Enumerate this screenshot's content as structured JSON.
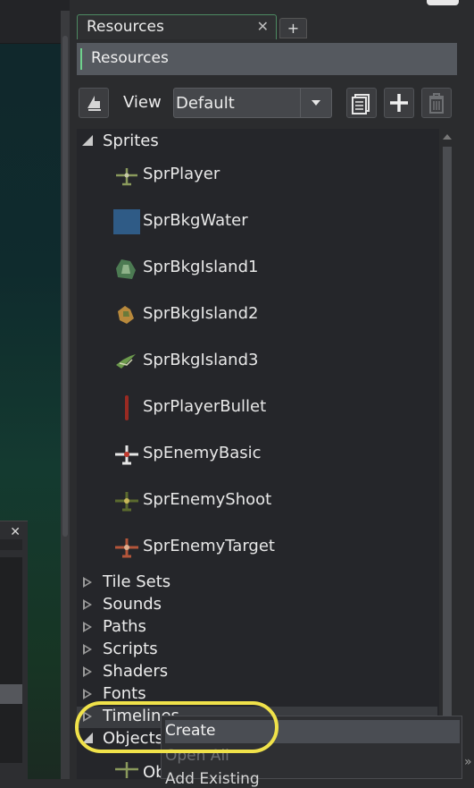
{
  "workspace": {
    "close_glyph": "✕"
  },
  "resources_tab": {
    "label": "Resources",
    "close_glyph": "✕",
    "add_glyph": "+"
  },
  "header": {
    "title": "Resources"
  },
  "toolbar": {
    "view_label": "View",
    "view_value": "Default",
    "buttons": [
      "collapse-icon",
      "copy-list-icon",
      "add-icon",
      "trash-icon"
    ]
  },
  "tree": {
    "sprites_label": "Sprites",
    "sprites": [
      {
        "name": "SprPlayer",
        "icon": "plane-icon"
      },
      {
        "name": "SprBkgWater",
        "icon": "water-tile-icon"
      },
      {
        "name": "SprBkgIsland1",
        "icon": "island-icon"
      },
      {
        "name": "SprBkgIsland2",
        "icon": "island-icon"
      },
      {
        "name": "SprBkgIsland3",
        "icon": "island-icon"
      },
      {
        "name": "SprPlayerBullet",
        "icon": "bullet-icon"
      },
      {
        "name": "SpEnemyBasic",
        "icon": "plane-icon"
      },
      {
        "name": "SprEnemyShoot",
        "icon": "plane-icon"
      },
      {
        "name": "SprEnemyTarget",
        "icon": "plane-icon"
      }
    ],
    "groups": [
      "Tile Sets",
      "Sounds",
      "Paths",
      "Scripts",
      "Shaders",
      "Fonts",
      "Timelines"
    ],
    "objects_label": "Objects",
    "objects_child": "Ob"
  },
  "context_menu": {
    "items": [
      "Create",
      "Open All",
      "Add Existing"
    ]
  },
  "colors": {
    "accent": "#6fd28d",
    "highlight_ring": "#f0e24a",
    "water": "#2f5b86"
  }
}
